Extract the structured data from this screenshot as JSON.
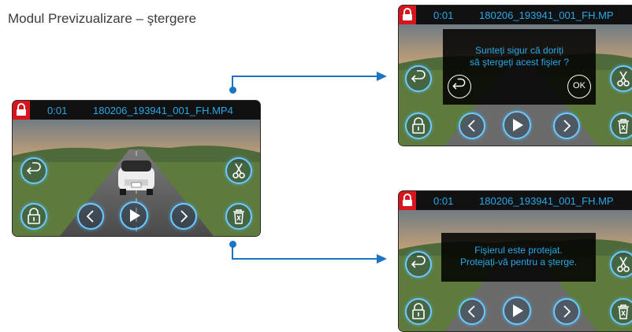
{
  "page_title": "Modul Previzualizare – ştergere",
  "screens": {
    "main": {
      "time": "0:01",
      "file": "180206_193941_001_FH.MP4"
    },
    "confirm": {
      "time": "0:01",
      "file": "180206_193941_001_FH.MP",
      "dialog_line1": "Sunteți sigur că doriți",
      "dialog_line2": "să ştergeți acest fişier ?",
      "ok_label": "OK"
    },
    "protected": {
      "time": "0:01",
      "file": "180206_193941_001_FH.MP",
      "dialog_line1": "Fişierul este protejat.",
      "dialog_line2": "Protejați-vă pentru a şterge."
    }
  },
  "colors": {
    "accent": "#2aa8e8",
    "lock_badge": "#d8141c",
    "connector": "#1b75c4",
    "button_glow": "#6ec9ff"
  },
  "icons": [
    "lock-icon",
    "back-icon",
    "cut-icon",
    "unlock-icon",
    "prev-icon",
    "play-icon",
    "next-icon",
    "delete-icon"
  ]
}
